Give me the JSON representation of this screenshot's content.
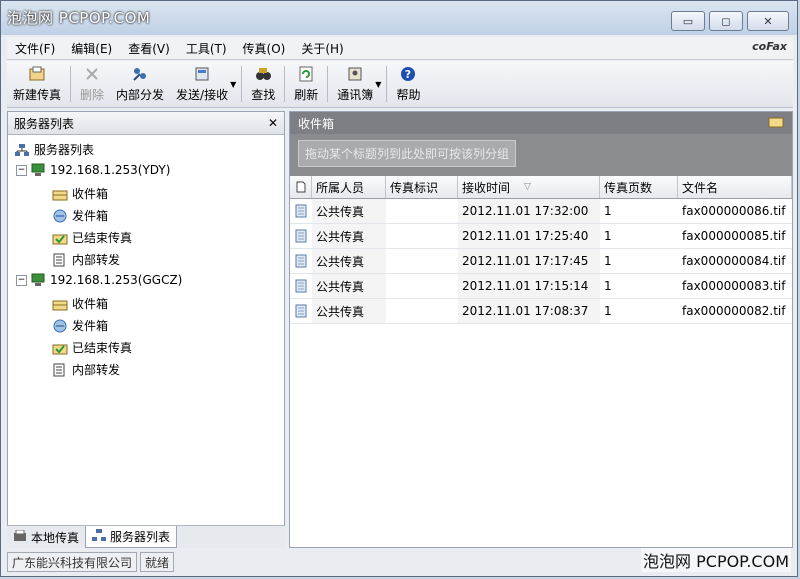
{
  "watermark_top": "泡泡网 PCPOP.COM",
  "window_buttons": {
    "minimize": "▭",
    "maximize": "◻",
    "close": "✕"
  },
  "menu": [
    "文件(F)",
    "编辑(E)",
    "查看(V)",
    "工具(T)",
    "传真(O)",
    "关于(H)"
  ],
  "logo": "coFax",
  "toolbar": {
    "new_fax": "新建传真",
    "delete": "删除",
    "internal_dist": "内部分发",
    "send_recv": "发送/接收",
    "find": "查找",
    "refresh": "刷新",
    "address_book": "通讯簿",
    "help": "帮助"
  },
  "left_panel": {
    "title": "服务器列表",
    "close": "✕",
    "root": "服务器列表",
    "servers": [
      {
        "name": "192.168.1.253(YDY)",
        "folders": [
          "收件箱",
          "发件箱",
          "已结束传真",
          "内部转发"
        ]
      },
      {
        "name": "192.168.1.253(GGCZ)",
        "folders": [
          "收件箱",
          "发件箱",
          "已结束传真",
          "内部转发"
        ]
      }
    ]
  },
  "left_tabs": [
    "本地传真",
    "服务器列表"
  ],
  "right_panel": {
    "title": "收件箱",
    "group_hint": "拖动某个标题列到此处即可按该列分组",
    "columns": [
      "所属人员",
      "传真标识",
      "接收时间",
      "传真页数",
      "文件名"
    ],
    "rows": [
      {
        "owner": "公共传真",
        "fax_id": "",
        "time": "2012.11.01 17:32:00",
        "pages": "1",
        "file": "fax000000086.tif"
      },
      {
        "owner": "公共传真",
        "fax_id": "",
        "time": "2012.11.01 17:25:40",
        "pages": "1",
        "file": "fax000000085.tif"
      },
      {
        "owner": "公共传真",
        "fax_id": "",
        "time": "2012.11.01 17:17:45",
        "pages": "1",
        "file": "fax000000084.tif"
      },
      {
        "owner": "公共传真",
        "fax_id": "",
        "time": "2012.11.01 17:15:14",
        "pages": "1",
        "file": "fax000000083.tif"
      },
      {
        "owner": "公共传真",
        "fax_id": "",
        "time": "2012.11.01 17:08:37",
        "pages": "1",
        "file": "fax000000082.tif"
      }
    ]
  },
  "status": {
    "company": "广东能兴科技有限公司",
    "state": "就绪"
  },
  "watermark_bottom": "泡泡网 PCPOP.COM"
}
